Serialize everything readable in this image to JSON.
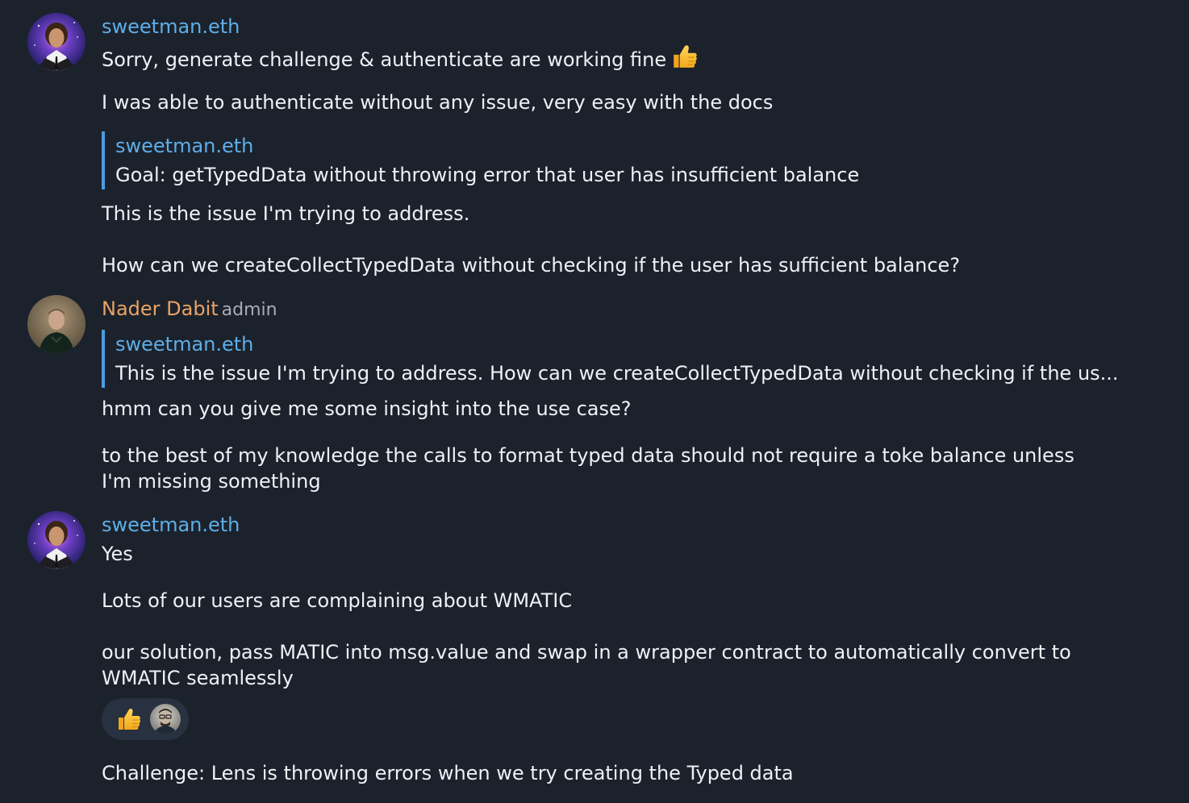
{
  "messages": [
    {
      "author": "sweetman.eth",
      "avatar_icon": "user-avatar-sweetman",
      "lines": [
        "Sorry, generate challenge & authenticate are working fine",
        "I was able to authenticate without any issue, very easy with the docs",
        "This is the issue I'm trying to address.",
        "How can we createCollectTypedData without checking if the user has sufficient balance?"
      ],
      "emoji": "thumbs-up-icon",
      "quote": {
        "author": "sweetman.eth",
        "text": "Goal: getTypedData without throwing error that user has insufficient balance"
      }
    },
    {
      "author": "Nader Dabit",
      "role": "admin",
      "avatar_icon": "user-avatar-nader",
      "quote": {
        "author": "sweetman.eth",
        "text": "This is the issue I'm trying to address.  How can we createCollectTypedData without checking if the us..."
      },
      "lines": [
        "hmm can you give me some insight into the use case?",
        "to the best of my knowledge the calls to format typed data should not require a toke balance unless",
        "I'm missing something"
      ]
    },
    {
      "author": "sweetman.eth",
      "avatar_icon": "user-avatar-sweetman",
      "lines": [
        "Yes",
        "Lots of our users are complaining about WMATIC",
        "our solution, pass MATIC into msg.value and swap in a wrapper contract to automatically convert to",
        "WMATIC seamlessly",
        "Challenge: Lens is throwing errors when we try creating the Typed data"
      ],
      "reaction": {
        "emoji": "thumbs-up-icon",
        "reactor_avatar": "reactor-avatar"
      }
    }
  ],
  "colors": {
    "background": "#1c222c",
    "text": "#eef1f5",
    "link_blue": "#5eaee8",
    "author_orange": "#e8a366",
    "quote_bar": "#4c9cdf",
    "muted": "#a6adb8"
  }
}
